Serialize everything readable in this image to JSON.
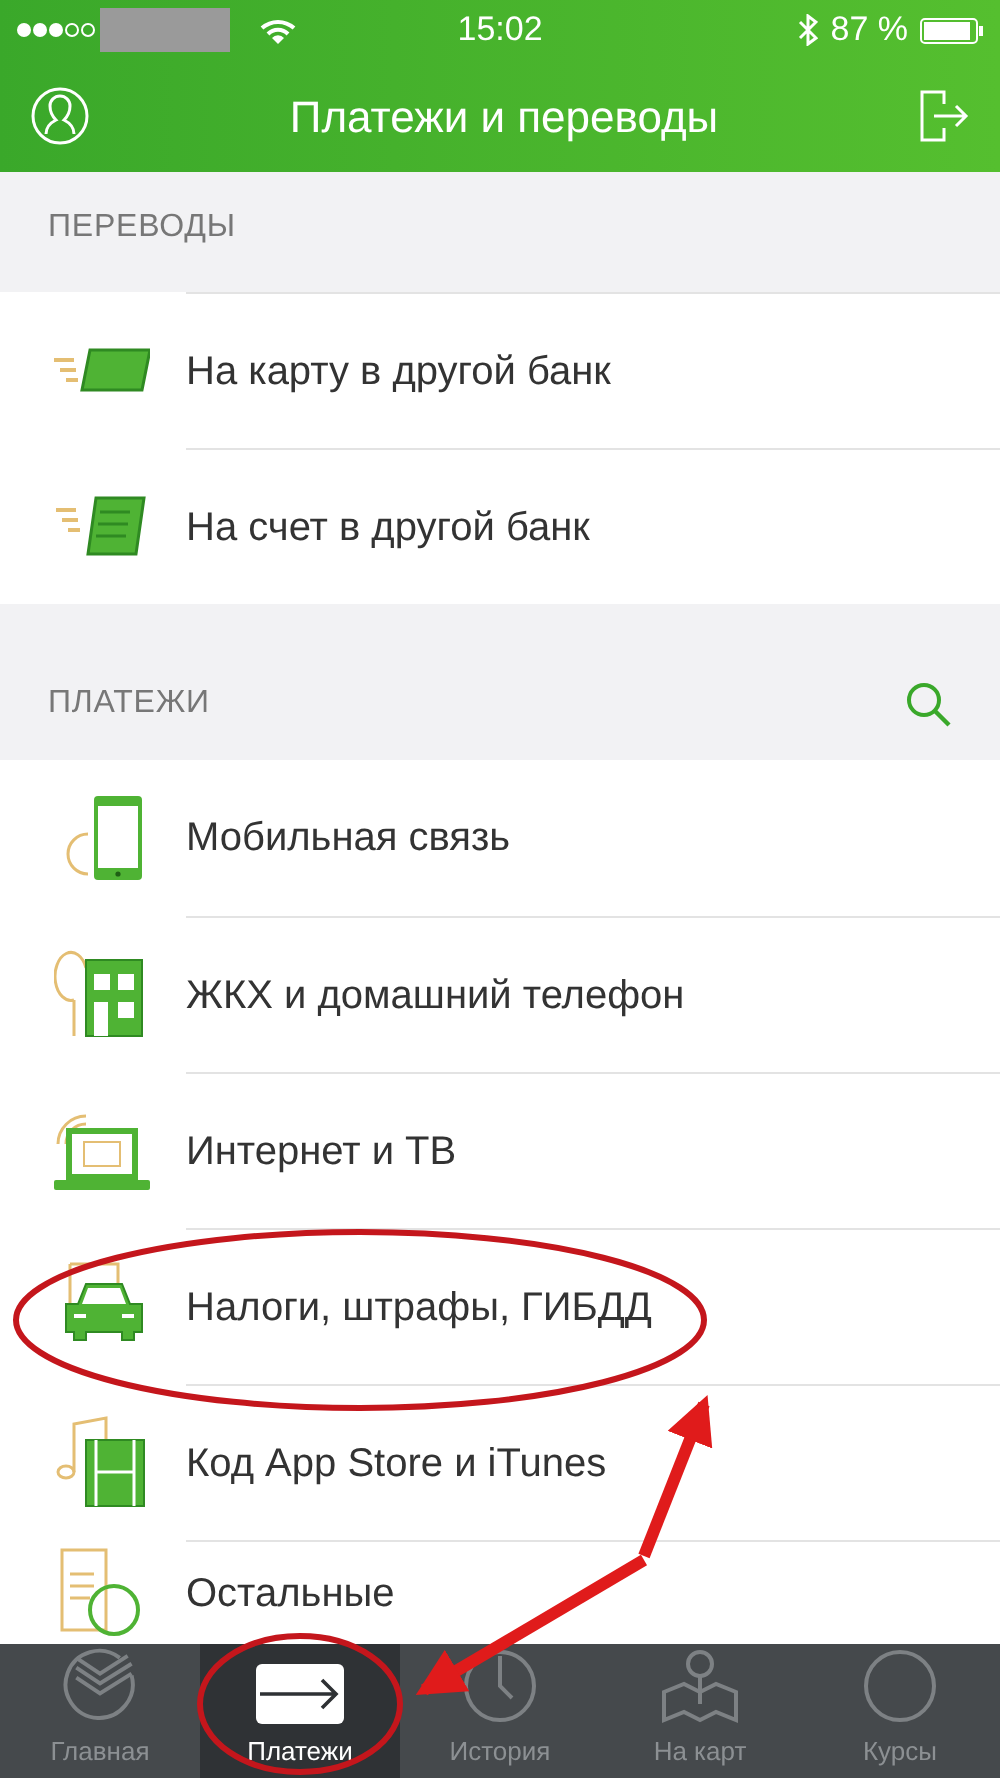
{
  "status_bar": {
    "time": "15:02",
    "battery": "87 %"
  },
  "header": {
    "title": "Платежи и переводы"
  },
  "sections": [
    {
      "title": "ПЕРЕВОДЫ",
      "search": false,
      "items": [
        {
          "label": "На карту в другой банк",
          "kind": "card"
        },
        {
          "label": "На счет в другой банк",
          "kind": "account"
        }
      ]
    },
    {
      "title": "ПЛАТЕЖИ",
      "search": true,
      "items": [
        {
          "label": "Мобильная связь",
          "kind": "mobile"
        },
        {
          "label": "ЖКХ и домашний телефон",
          "kind": "house"
        },
        {
          "label": "Интернет и ТВ",
          "kind": "internet"
        },
        {
          "label": "Налоги, штрафы, ГИБДД",
          "kind": "car"
        },
        {
          "label": "Код App Store и iTunes",
          "kind": "media"
        },
        {
          "label": "Остальные",
          "kind": "other"
        }
      ]
    }
  ],
  "tab_bar": [
    {
      "label": "Главная",
      "kind": "home",
      "selected": false
    },
    {
      "label": "Платежи",
      "kind": "payments",
      "selected": true
    },
    {
      "label": "История",
      "kind": "history",
      "selected": false
    },
    {
      "label": "На карт",
      "kind": "map",
      "selected": false
    },
    {
      "label": "Курсы",
      "kind": "rates",
      "selected": false
    }
  ]
}
